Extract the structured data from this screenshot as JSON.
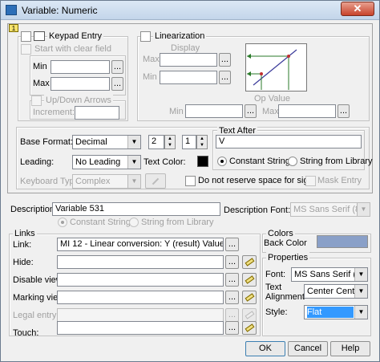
{
  "window": {
    "title": "Variable: Numeric",
    "close": "✕"
  },
  "tab_label": "1",
  "keypad": {
    "label": "Keypad Entry",
    "start_clear": "Start with clear field",
    "min": "Min",
    "max": "Max",
    "updown": "Up/Down Arrows",
    "increment": "Increment:"
  },
  "linearization": {
    "label": "Linearization",
    "display": "Display",
    "max": "Max",
    "min": "Min",
    "op_value": "Op Value",
    "op_min": "Min",
    "op_max": "Max"
  },
  "format": {
    "base_label": "Base Format:",
    "base_value": "Decimal",
    "digits_int": "2",
    "digits_dec": "1",
    "leading_label": "Leading:",
    "leading_value": "No Leading",
    "text_color_label": "Text Color:",
    "keyboard_label": "Keyboard Type:",
    "keyboard_value": "Complex",
    "no_reserve": "Do not reserve space for sign",
    "mask_entry": "Mask Entry"
  },
  "text_after": {
    "label": "Text After",
    "value": "V",
    "constant": "Constant String",
    "library": "String from Library"
  },
  "description": {
    "label": "Description:",
    "value": "Variable 531",
    "font_label": "Description Font:",
    "font_value": "MS Sans Serif (8)",
    "constant": "Constant String",
    "library": "String from Library"
  },
  "links": {
    "label": "Links",
    "link_label": "Link:",
    "link_value": "MI 12 - Linear conversion: Y (result) Value",
    "hide": "Hide:",
    "disable": "Disable view:",
    "marking": "Marking view:",
    "legal": "Legal entry:",
    "touch": "Touch:"
  },
  "colors": {
    "label": "Colors",
    "back_color": "Back Color",
    "back_color_value": "#8aa0c8"
  },
  "properties": {
    "label": "Properties",
    "font_label": "Font:",
    "font_value": "MS Sans Serif (10,B",
    "align_label_1": "Text",
    "align_label_2": "Alignment",
    "align_value": "Center Center",
    "style_label": "Style:",
    "style_value": "Flat"
  },
  "buttons": {
    "ok": "OK",
    "cancel": "Cancel",
    "help": "Help",
    "browse": "..."
  }
}
